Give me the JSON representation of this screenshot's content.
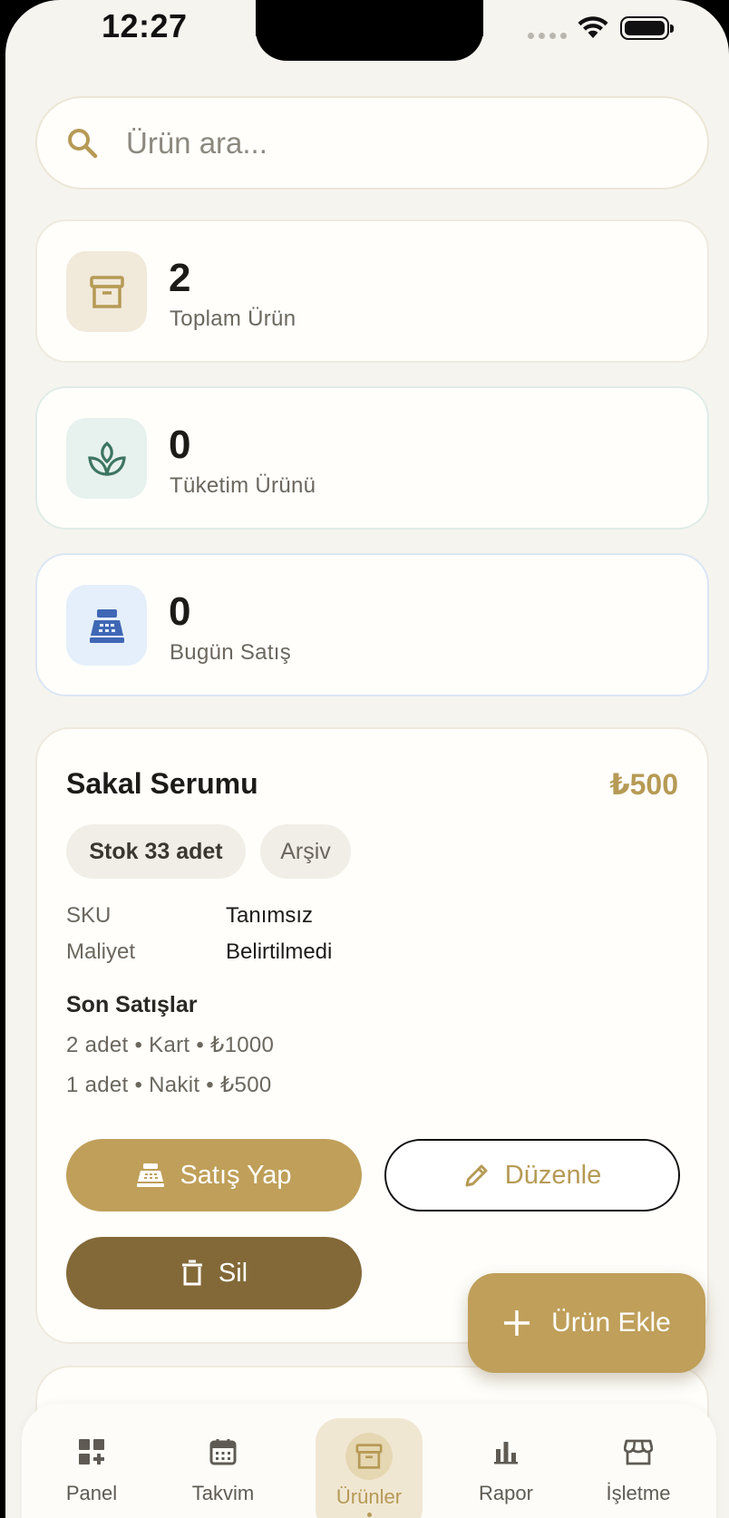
{
  "status_bar": {
    "time": "12:27"
  },
  "search": {
    "placeholder": "Ürün ara..."
  },
  "stats": [
    {
      "value": "2",
      "label": "Toplam Ürün",
      "icon": "archive-box-icon"
    },
    {
      "value": "0",
      "label": "Tüketim Ürünü",
      "icon": "leaf-plant-icon"
    },
    {
      "value": "0",
      "label": "Bugün Satış",
      "icon": "cash-register-icon"
    }
  ],
  "product": {
    "name": "Sakal Serumu",
    "price": "₺500",
    "stock_chip": "Stok 33 adet",
    "archive_chip": "Arşiv",
    "sku_label": "SKU",
    "sku_value": "Tanımsız",
    "cost_label": "Maliyet",
    "cost_value": "Belirtilmedi",
    "sales_title": "Son Satışlar",
    "sales": [
      "2 adet • Kart • ₺1000",
      "1 adet • Nakit • ₺500"
    ],
    "sell_button": "Satış Yap",
    "edit_button": "Düzenle",
    "delete_button": "Sil"
  },
  "fab": {
    "label": "Ürün Ekle"
  },
  "tabs": [
    {
      "label": "Panel",
      "icon": "dashboard-icon"
    },
    {
      "label": "Takvim",
      "icon": "calendar-icon"
    },
    {
      "label": "Ürünler",
      "icon": "archive-box-icon",
      "active": true
    },
    {
      "label": "Rapor",
      "icon": "bar-chart-icon"
    },
    {
      "label": "İşletme",
      "icon": "store-icon"
    }
  ],
  "colors": {
    "accent": "#bf9f59",
    "accent_text": "#b69a55",
    "delete": "#836938",
    "background": "#f6f4ef"
  }
}
